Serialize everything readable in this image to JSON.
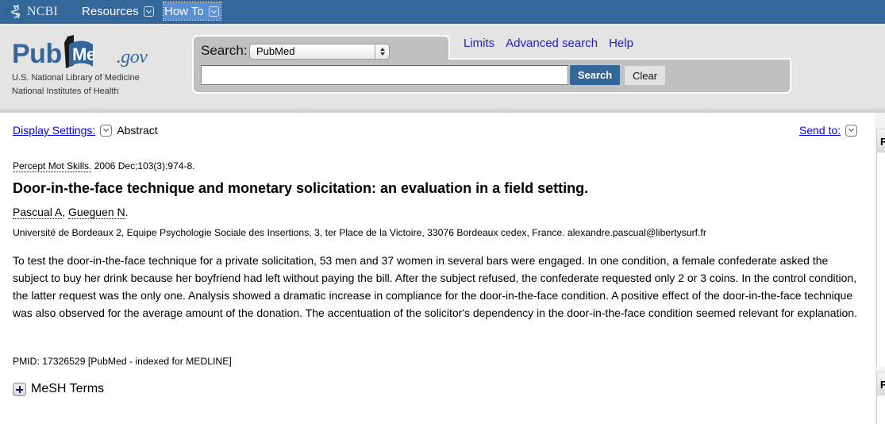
{
  "topbar": {
    "logo_text": "NCBI",
    "nav": [
      {
        "label": "Resources",
        "icon": "chevron-down-icon"
      },
      {
        "label": "How To",
        "icon": "chevron-down-icon"
      }
    ]
  },
  "header": {
    "logo": {
      "pub": "Pub",
      "med": "Med",
      "gov": ".gov",
      "line1": "U.S. National Library of Medicine",
      "line2": "National Institutes of Health"
    },
    "search": {
      "label": "Search:",
      "database": "PubMed",
      "query": "",
      "placeholder": "",
      "search_button": "Search",
      "clear_button": "Clear"
    },
    "links": [
      "Limits",
      "Advanced search",
      "Help"
    ]
  },
  "content": {
    "display_settings_label": "Display Settings:",
    "display_mode": "Abstract",
    "send_to_label": "Send to:",
    "citation": {
      "journal": "Percept Mot Skills.",
      "details": " 2006 Dec;103(3):974-8."
    },
    "title": "Door-in-the-face technique and monetary solicitation: an evaluation in a field setting.",
    "authors": [
      {
        "name": "Pascual A",
        "sep": ", "
      },
      {
        "name": "Gueguen N",
        "sep": "."
      }
    ],
    "affiliation": "Université de Bordeaux 2, Equipe Psychologie Sociale des Insertions, 3, ter Place de la Victoire, 33076 Bordeaux cedex, France. alexandre.pascual@libertysurf.fr",
    "abstract": "To test the door-in-the-face technique for a private solicitation, 53 men and 37 women in several bars were engaged. In one condition, a female confederate asked the subject to buy her drink because her boyfriend had left without paying the bill. After the subject refused, the confederate requested only 2 or 3 coins. In the control condition, the latter request was the only one. Analysis showed a dramatic increase in compliance for the door-in-the-face condition. A positive effect of the door-in-the-face technique was also observed for the average amount of the donation. The accentuation of the solicitor's dependency in the door-in-the-face condition seemed relevant for explanation.",
    "pmid": "PMID: 17326529 [PubMed - indexed for MEDLINE]",
    "mesh_label": "MeSH Terms"
  },
  "sidebar": {
    "panel_headers": [
      "F",
      "F"
    ]
  },
  "colors": {
    "ncbi_blue": "#336699",
    "header_gray": "#e4e4e4",
    "link_blue": "#0000ee"
  }
}
